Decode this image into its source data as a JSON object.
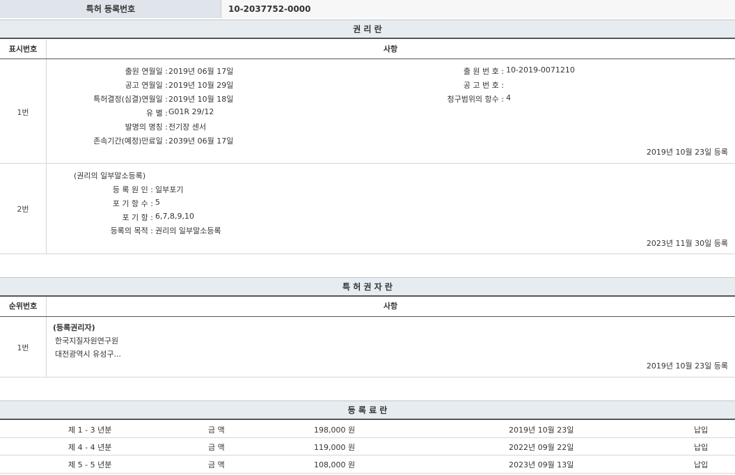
{
  "registration": {
    "label": "특허 등록번호",
    "number": "10-2037752-0000"
  },
  "rights_section": {
    "title": "권 리 란",
    "col_no": "표시번호",
    "col_items": "사항",
    "entry1": {
      "no": "1번",
      "left": [
        {
          "label": "출원 연월일 :",
          "value": "2019년 06월 17일"
        },
        {
          "label": "공고 연월일 :",
          "value": "2019년 10월 29일"
        },
        {
          "label": "특허결정(심결)연월일 :",
          "value": "2019년 10월 18일"
        },
        {
          "label": "유 별 :",
          "value": "G01R 29/12"
        },
        {
          "label": "발명의 명칭 :",
          "value": "전기장 센서"
        },
        {
          "label": "존속기간(예정)만료일 :",
          "value": "2039년 06월 17일"
        }
      ],
      "right": [
        {
          "label": "출 원 번 호 :",
          "value": "10-2019-0071210"
        },
        {
          "label": "공 고 번 호 :",
          "value": ""
        },
        {
          "label": "청구범위의 항수 :",
          "value": "4"
        }
      ],
      "reg_date": "2019년 10월 23일 등록"
    },
    "entry2": {
      "no": "2번",
      "heading": "(권리의 일부말소등록)",
      "fields": [
        {
          "label": "등 록 원 인 :",
          "value": "일부포기"
        },
        {
          "label": "포 기 항 수 :",
          "value": "5"
        },
        {
          "label": "포 기 항 :",
          "value": "6,7,8,9,10"
        },
        {
          "label": "등록의 목적 :",
          "value": "권리의 일부말소등록"
        }
      ],
      "reg_date": "2023년 11월 30일 등록"
    }
  },
  "holder_section": {
    "title": "특 허 권 자 란",
    "col_no": "순위번호",
    "col_items": "사항",
    "entry1": {
      "no": "1번",
      "heading": "(등록권리자)",
      "name": "한국지질자원연구원",
      "address": "대전광역시 유성구...",
      "reg_date": "2019년 10월 23일 등록"
    }
  },
  "fee_section": {
    "title": "등 록 료 란",
    "rows": [
      {
        "period": "제 1 - 3 년분",
        "label": "금 액",
        "amount": "198,000 원",
        "date": "2019년 10월 23일",
        "status": "납입"
      },
      {
        "period": "제 4 - 4 년분",
        "label": "금 액",
        "amount": "119,000 원",
        "date": "2022년 09월 22일",
        "status": "납입"
      },
      {
        "period": "제 5 - 5 년분",
        "label": "금 액",
        "amount": "108,000 원",
        "date": "2023년 09월 13일",
        "status": "납입"
      }
    ]
  }
}
